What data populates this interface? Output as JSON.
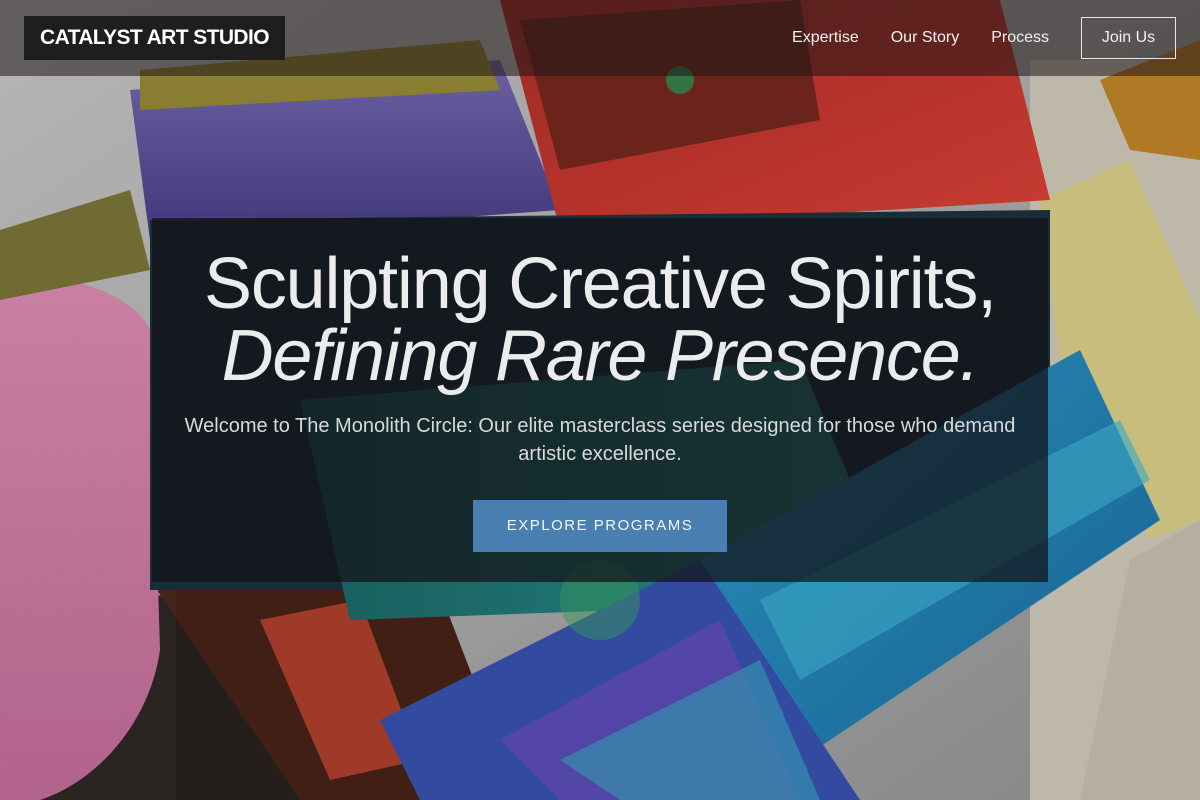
{
  "brand": {
    "name": "CATALYST ART STUDIO"
  },
  "nav": {
    "links": [
      {
        "label": "Expertise"
      },
      {
        "label": "Our Story"
      },
      {
        "label": "Process"
      }
    ],
    "join_label": "Join Us"
  },
  "hero": {
    "headline_line1": "Sculpting Creative Spirits,",
    "headline_line2": "Defining Rare Presence.",
    "subtitle": "Welcome to The Monolith Circle: Our elite masterclass series designed for those who demand artistic excellence.",
    "cta_label": "EXPLORE PROGRAMS",
    "background_image": "paint-brushes-photo"
  },
  "colors": {
    "cta_background": "#4a7fb2",
    "logo_background": "#1e1e1e",
    "panel_overlay": "rgba(18,18,22,0.72)"
  }
}
